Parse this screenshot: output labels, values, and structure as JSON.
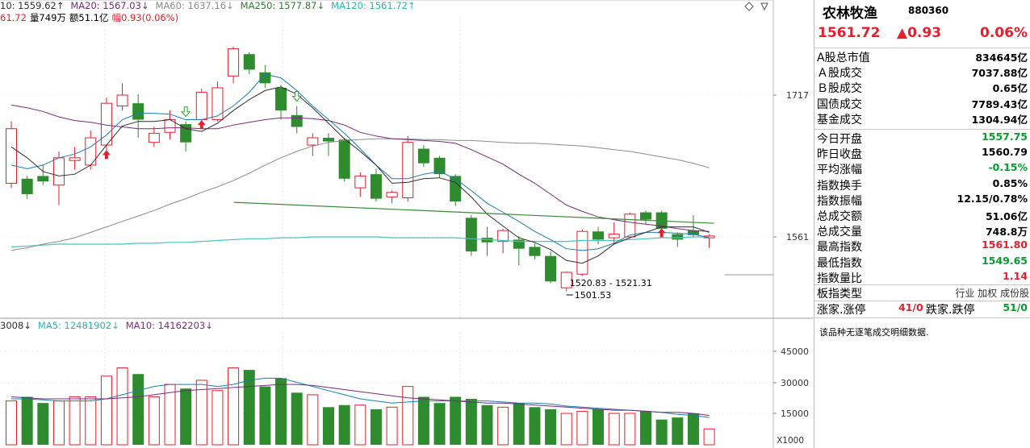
{
  "legend": {
    "ma10": "10: 1559.62↑",
    "ma20": "MA20: 1567.03↓",
    "ma60": "MA60: 1637.16↓",
    "ma250": "MA250: 1577.87↓",
    "ma120": "MA120: 1561.72↑",
    "info_price": "61.72",
    "info_vol": "量749万",
    "info_amt": "额51.1亿",
    "info_amp": "幅0.93(0.06%)",
    "vol_ma": "3008↓",
    "vol_ma5": "MA5: 12481902↓",
    "vol_ma10": "MA10: 14162203↓"
  },
  "colors": {
    "up": "#e5202e",
    "down": "#2e8b2e",
    "ma10": "#2f2f2f",
    "ma20": "#7a2a78",
    "ma60": "#8c8c8c",
    "ma250": "#3a8a3a",
    "ma120": "#46c4c4"
  },
  "price_axis": {
    "labels": [
      "1717",
      "1561"
    ]
  },
  "volume_axis": {
    "labels": [
      "45000",
      "30000",
      "15000"
    ],
    "unit": "X1000"
  },
  "annotations": {
    "range": "1520.83 - 1521.31",
    "low": "1501.53"
  },
  "candles": [
    {
      "o": 1620,
      "c": 1680,
      "h": 1688,
      "l": 1615,
      "v": 21
    },
    {
      "o": 1625,
      "c": 1608,
      "h": 1628,
      "l": 1603,
      "v": 23
    },
    {
      "o": 1628,
      "c": 1622,
      "h": 1640,
      "l": 1618,
      "v": 20
    },
    {
      "o": 1618,
      "c": 1648,
      "h": 1655,
      "l": 1596,
      "v": 21
    },
    {
      "o": 1645,
      "c": 1648,
      "h": 1660,
      "l": 1635,
      "v": 23
    },
    {
      "o": 1640,
      "c": 1670,
      "h": 1678,
      "l": 1635,
      "v": 23
    },
    {
      "o": 1662,
      "c": 1708,
      "h": 1714,
      "l": 1652,
      "v": 33
    },
    {
      "o": 1705,
      "c": 1717,
      "h": 1730,
      "l": 1700,
      "v": 37
    },
    {
      "o": 1708,
      "c": 1690,
      "h": 1718,
      "l": 1670,
      "v": 34
    },
    {
      "o": 1665,
      "c": 1675,
      "h": 1682,
      "l": 1660,
      "v": 23
    },
    {
      "o": 1676,
      "c": 1690,
      "h": 1700,
      "l": 1668,
      "v": 29
    },
    {
      "o": 1685,
      "c": 1665,
      "h": 1688,
      "l": 1655,
      "v": 27
    },
    {
      "o": 1690,
      "c": 1720,
      "h": 1724,
      "l": 1685,
      "v": 31
    },
    {
      "o": 1690,
      "c": 1725,
      "h": 1732,
      "l": 1688,
      "v": 26
    },
    {
      "o": 1738,
      "c": 1768,
      "h": 1770,
      "l": 1730,
      "v": 37
    },
    {
      "o": 1762,
      "c": 1745,
      "h": 1764,
      "l": 1740,
      "v": 36
    },
    {
      "o": 1742,
      "c": 1730,
      "h": 1750,
      "l": 1725,
      "v": 28
    },
    {
      "o": 1725,
      "c": 1700,
      "h": 1728,
      "l": 1690,
      "v": 32
    },
    {
      "o": 1695,
      "c": 1682,
      "h": 1705,
      "l": 1675,
      "v": 25
    },
    {
      "o": 1662,
      "c": 1670,
      "h": 1675,
      "l": 1650,
      "v": 24
    },
    {
      "o": 1670,
      "c": 1666,
      "h": 1675,
      "l": 1650,
      "v": 18
    },
    {
      "o": 1668,
      "c": 1625,
      "h": 1670,
      "l": 1622,
      "v": 19
    },
    {
      "o": 1615,
      "c": 1628,
      "h": 1632,
      "l": 1605,
      "v": 19
    },
    {
      "o": 1630,
      "c": 1603,
      "h": 1636,
      "l": 1600,
      "v": 17
    },
    {
      "o": 1605,
      "c": 1610,
      "h": 1612,
      "l": 1598,
      "v": 18
    },
    {
      "o": 1604,
      "c": 1665,
      "h": 1672,
      "l": 1600,
      "v": 28
    },
    {
      "o": 1658,
      "c": 1642,
      "h": 1662,
      "l": 1638,
      "v": 23
    },
    {
      "o": 1648,
      "c": 1630,
      "h": 1650,
      "l": 1626,
      "v": 20
    },
    {
      "o": 1628,
      "c": 1600,
      "h": 1630,
      "l": 1595,
      "v": 23
    },
    {
      "o": 1582,
      "c": 1545,
      "h": 1585,
      "l": 1540,
      "v": 22
    },
    {
      "o": 1560,
      "c": 1555,
      "h": 1572,
      "l": 1540,
      "v": 19
    },
    {
      "o": 1556,
      "c": 1568,
      "h": 1570,
      "l": 1543,
      "v": 18
    },
    {
      "o": 1558,
      "c": 1548,
      "h": 1562,
      "l": 1530,
      "v": 20
    },
    {
      "o": 1550,
      "c": 1540,
      "h": 1554,
      "l": 1536,
      "v": 18
    },
    {
      "o": 1540,
      "c": 1512,
      "h": 1545,
      "l": 1510,
      "v": 17
    },
    {
      "o": 1505,
      "c": 1522,
      "h": 1523,
      "l": 1501,
      "v": 15
    },
    {
      "o": 1520,
      "c": 1567,
      "h": 1569,
      "l": 1518,
      "v": 16
    },
    {
      "o": 1567,
      "c": 1558,
      "h": 1572,
      "l": 1553,
      "v": 17
    },
    {
      "o": 1560,
      "c": 1564,
      "h": 1577,
      "l": 1553,
      "v": 15
    },
    {
      "o": 1561,
      "c": 1586,
      "h": 1588,
      "l": 1560,
      "v": 15
    },
    {
      "o": 1588,
      "c": 1580,
      "h": 1590,
      "l": 1575,
      "v": 16
    },
    {
      "o": 1588,
      "c": 1570,
      "h": 1590,
      "l": 1566,
      "v": 12
    },
    {
      "o": 1564,
      "c": 1558,
      "h": 1566,
      "l": 1550,
      "v": 13
    },
    {
      "o": 1568,
      "c": 1563,
      "h": 1585,
      "l": 1560,
      "v": 15
    },
    {
      "o": 1560,
      "c": 1562,
      "h": 1564,
      "l": 1549,
      "v": 7.5
    }
  ],
  "ma10_line": [
    1640,
    1636,
    1640,
    1648,
    1652,
    1660,
    1673,
    1690,
    1697,
    1697,
    1696,
    1690,
    1690,
    1694,
    1705,
    1720,
    1740,
    1736,
    1722,
    1705,
    1690,
    1675,
    1658,
    1640,
    1625,
    1625,
    1630,
    1633,
    1625,
    1612,
    1598,
    1588,
    1578,
    1567,
    1558,
    1548,
    1546,
    1548,
    1554,
    1563,
    1566,
    1566,
    1565,
    1564,
    1560
  ],
  "ma20_line": [
    1706,
    1703,
    1699,
    1693,
    1689,
    1687,
    1684,
    1682,
    1680,
    1680,
    1681,
    1681,
    1680,
    1680,
    1684,
    1687,
    1690,
    1692,
    1692,
    1691,
    1689,
    1684,
    1676,
    1672,
    1669,
    1668,
    1667,
    1666,
    1664,
    1657,
    1649,
    1641,
    1630,
    1620,
    1608,
    1596,
    1589,
    1583,
    1580,
    1577,
    1575,
    1573,
    1570,
    1568,
    1567
  ],
  "ma5_line": [
    1660,
    1648,
    1633,
    1628,
    1630,
    1640,
    1662,
    1683,
    1688,
    1688,
    1690,
    1680,
    1677,
    1686,
    1700,
    1712,
    1722,
    1726,
    1718,
    1703,
    1686,
    1669,
    1655,
    1640,
    1620,
    1621,
    1625,
    1626,
    1621,
    1605,
    1586,
    1573,
    1560,
    1555,
    1547,
    1535,
    1532,
    1540,
    1553,
    1560,
    1566,
    1572,
    1572,
    1572,
    1566
  ],
  "ma60_line": [
    1546,
    1549,
    1553,
    1556,
    1560,
    1566,
    1572,
    1578,
    1584,
    1590,
    1597,
    1603,
    1610,
    1616,
    1623,
    1631,
    1640,
    1648,
    1655,
    1661,
    1665,
    1667,
    1668,
    1669,
    1669,
    1669,
    1668,
    1668,
    1667,
    1667,
    1666,
    1665,
    1664,
    1664,
    1663,
    1662,
    1661,
    1659,
    1657,
    1655,
    1652,
    1649,
    1646,
    1642,
    1637
  ],
  "ma120_line": [
    1550,
    1551,
    1552,
    1553,
    1553,
    1553,
    1553,
    1553,
    1554,
    1554,
    1555,
    1555,
    1556,
    1557,
    1558,
    1559,
    1559,
    1560,
    1560,
    1561,
    1561,
    1561,
    1561,
    1561,
    1560,
    1560,
    1560,
    1560,
    1560,
    1559,
    1558,
    1557,
    1556,
    1556,
    1556,
    1556,
    1557,
    1557,
    1557,
    1558,
    1559,
    1560,
    1560,
    1561,
    1561
  ],
  "ma250_segment": {
    "from": 1599,
    "to": 1576
  },
  "vol_ma5_line": [
    22,
    22,
    21.5,
    21,
    21,
    21,
    22,
    24,
    26,
    28,
    29,
    29,
    29,
    28,
    29,
    31,
    32,
    32,
    30,
    28,
    26,
    24,
    22,
    21,
    20,
    20.5,
    21,
    21,
    21,
    21,
    21,
    20.5,
    20,
    20,
    19.5,
    18.5,
    18,
    17.5,
    17,
    16.5,
    16,
    15.5,
    14.5,
    14,
    13
  ],
  "vol_ma10_line": [
    23,
    22.5,
    22,
    22,
    22,
    22,
    22,
    22.5,
    23,
    24,
    25,
    26,
    26.5,
    27,
    27.5,
    28,
    28.5,
    29,
    29,
    28.5,
    27.5,
    26.5,
    25.5,
    24.5,
    23.5,
    22.5,
    22,
    21.5,
    21,
    20.5,
    20,
    20,
    19.5,
    19,
    18.5,
    18,
    17.5,
    17,
    16.5,
    16.5,
    16,
    15.5,
    15.5,
    15,
    14
  ],
  "signals": {
    "up_arrows": [
      6,
      12,
      41
    ],
    "down_hollow": [
      11,
      18
    ]
  },
  "panel": {
    "title": "农林牧渔",
    "code": "880360",
    "price": "1561.72",
    "change": "▲0.93",
    "pct": "0.06%",
    "rows_a": [
      {
        "label": "A股总市值",
        "value": "834645亿",
        "color": "blk"
      },
      {
        "label": "Ａ股成交",
        "value": "7037.88亿",
        "color": "blk"
      },
      {
        "label": "Ｂ股成交",
        "value": "0.65亿",
        "color": "blk"
      },
      {
        "label": "国债成交",
        "value": "7789.43亿",
        "color": "blk"
      },
      {
        "label": "基金成交",
        "value": "1304.94亿",
        "color": "blk"
      }
    ],
    "rows_b": [
      {
        "label": "今日开盘",
        "value": "1557.75",
        "color": "green"
      },
      {
        "label": "昨日收盘",
        "value": "1560.79",
        "color": "blk"
      },
      {
        "label": "平均涨幅",
        "value": "-0.15%",
        "color": "green"
      },
      {
        "label": "指数换手",
        "value": "0.85%",
        "color": "blk"
      },
      {
        "label": "指数振幅",
        "value": "12.15/0.78%",
        "color": "blk"
      },
      {
        "label": "总成交额",
        "value": "51.06亿",
        "color": "blk"
      },
      {
        "label": "总成交量",
        "value": "748.8万",
        "color": "blk"
      },
      {
        "label": "最高指数",
        "value": "1561.80",
        "color": "red"
      },
      {
        "label": "最低指数",
        "value": "1549.65",
        "color": "green"
      },
      {
        "label": "指数量比",
        "value": "1.14",
        "color": "red"
      }
    ],
    "types_label": "板指类型",
    "types_opts": "行业 加权 成份股",
    "breadth_label1": "涨家.涨停",
    "breadth_val1": "41/0",
    "breadth_label2": "跌家.跌停",
    "breadth_val2": "51/0",
    "no_detail": "该品种无逐笔成交明细数据."
  }
}
